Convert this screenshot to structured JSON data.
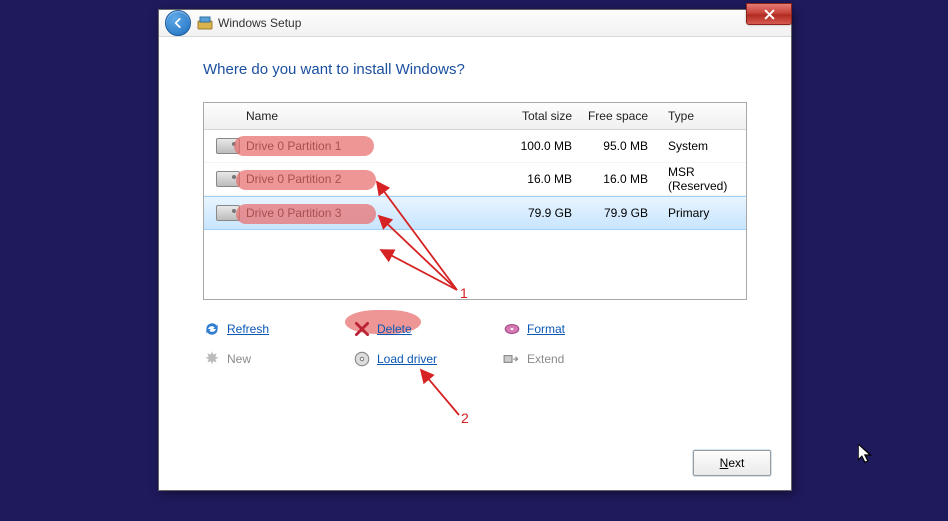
{
  "window": {
    "title": "Windows Setup",
    "heading": "Where do you want to install Windows?"
  },
  "columns": {
    "name": "Name",
    "total": "Total size",
    "free": "Free space",
    "type": "Type"
  },
  "rows": [
    {
      "name": "Drive 0 Partition 1",
      "total": "100.0 MB",
      "free": "95.0 MB",
      "type": "System",
      "selected": false
    },
    {
      "name": "Drive 0 Partition 2",
      "total": "16.0 MB",
      "free": "16.0 MB",
      "type": "MSR (Reserved)",
      "selected": false
    },
    {
      "name": "Drive 0 Partition 3",
      "total": "79.9 GB",
      "free": "79.9 GB",
      "type": "Primary",
      "selected": true
    }
  ],
  "actions": {
    "refresh": "Refresh",
    "delete": "Delete",
    "format": "Format",
    "new": "New",
    "load_driver": "Load driver",
    "extend": "Extend"
  },
  "next_label": "Next",
  "annotations": {
    "label1": "1",
    "label2": "2"
  }
}
